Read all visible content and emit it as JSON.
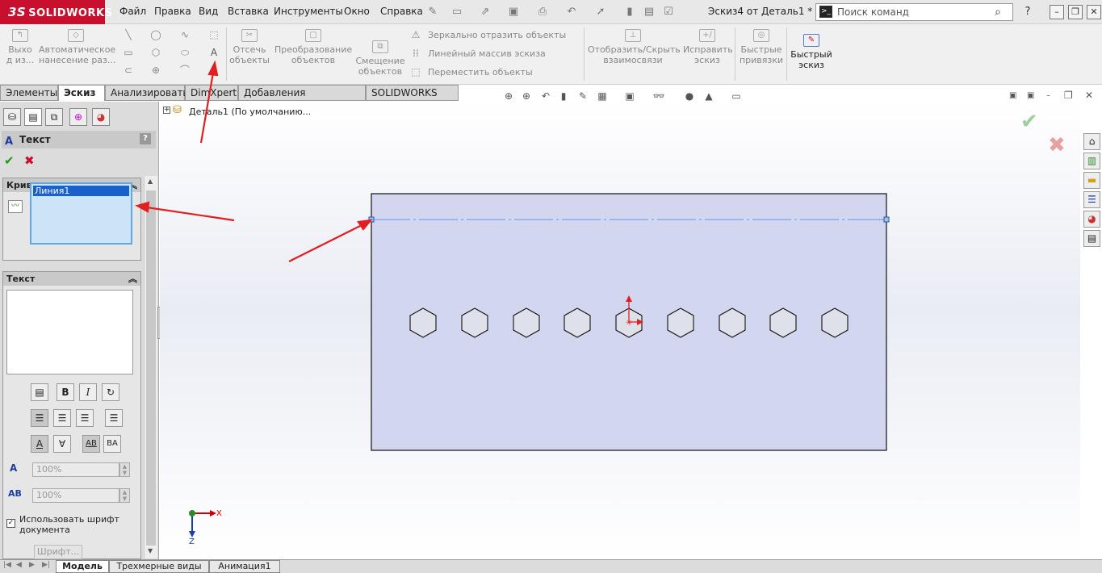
{
  "app": {
    "brand": "SOLIDWORKS",
    "brand_prefix": "3S",
    "doc_title": "Эскиз4 от Деталь1 *"
  },
  "menu": [
    "Файл",
    "Правка",
    "Вид",
    "Вставка",
    "Инструменты",
    "Окно",
    "Справка"
  ],
  "search": {
    "placeholder": "Поиск команд"
  },
  "ribbon": {
    "exit_sketch": "Выхо\nд из...",
    "smart_dim": "Автоматическое\nнанесение раз...",
    "trim": "Отсечь\nобъекты",
    "convert": "Преобразование\nобъектов",
    "offset": "Смещение\nобъектов",
    "mirror": "Зеркально отразить объекты",
    "linear_pattern": "Линейный массив эскиза",
    "move": "Переместить объекты",
    "show_relations": "Отобразить/Скрыть\nвзаимосвязи",
    "repair": "Исправить\nэскиз",
    "quick_snaps": "Быстрые\nпривязки",
    "rapid_sketch": "Быстрый\nэскиз"
  },
  "tabs": [
    "Элементы",
    "Эскиз",
    "Анализировать",
    "DimXpert",
    "Добавления SOLIDWORKS",
    "SOLIDWORKS MBD"
  ],
  "active_tab": "Эскиз",
  "tree": {
    "root": "Деталь1  (По умолчанию..."
  },
  "property_manager": {
    "title": "Текст",
    "help": "?",
    "curves_group": {
      "title": "Кривые",
      "items": [
        "Линия1"
      ]
    },
    "text_group": {
      "title": "Текст",
      "bold": "B",
      "italic": "I",
      "width_factor": "100%",
      "spacing": "100%",
      "use_doc_font": "Использовать шрифт документа",
      "font_button": "Шрифт...",
      "flip_labels": [
        "A",
        "∀",
        "AB",
        "BA"
      ]
    }
  },
  "triad": {
    "x": "X",
    "z": "Z"
  },
  "bottom_tabs": [
    "Модель",
    "Трехмерные виды",
    "Анимация1"
  ],
  "active_bottom_tab": "Модель",
  "colors": {
    "accent": "#c8102e",
    "sketch_fill": "#d2d6ee",
    "annotation_arrow": "#e02020"
  }
}
